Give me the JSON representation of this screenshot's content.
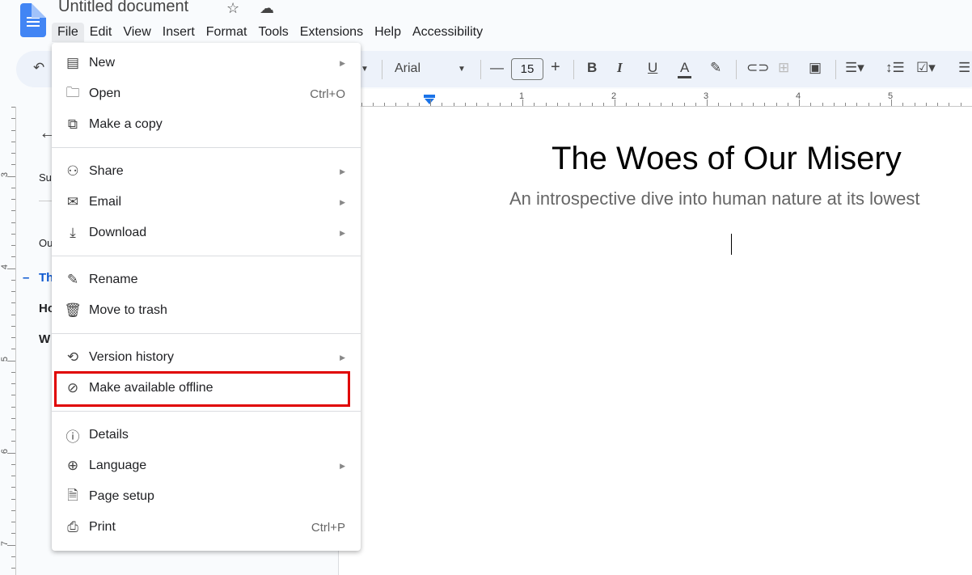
{
  "app": {
    "title": "Untitled document",
    "menu": [
      "File",
      "Edit",
      "View",
      "Insert",
      "Format",
      "Tools",
      "Extensions",
      "Help",
      "Accessibility"
    ]
  },
  "toolbar": {
    "font": "Arial",
    "font_size": "15"
  },
  "ruler": {
    "h": [
      "1",
      "2",
      "3",
      "4",
      "5"
    ],
    "v": [
      "3",
      "4",
      "5",
      "6",
      "7"
    ]
  },
  "sidebar": {
    "summary": "Su",
    "outline": "Ou",
    "items": [
      "Th",
      "Ho",
      "W"
    ],
    "accent": "#0b57d0"
  },
  "document": {
    "title": "The Woes of Our Misery",
    "subtitle": "An introspective dive into human nature at its lowest"
  },
  "file_menu": {
    "groups": [
      [
        {
          "label": "New",
          "icon": "document-icon",
          "submenu": true
        },
        {
          "label": "Open",
          "icon": "folder-icon",
          "shortcut": "Ctrl+O"
        },
        {
          "label": "Make a copy",
          "icon": "copy-icon"
        }
      ],
      [
        {
          "label": "Share",
          "icon": "person-add-icon",
          "submenu": true
        },
        {
          "label": "Email",
          "icon": "email-icon",
          "submenu": true
        },
        {
          "label": "Download",
          "icon": "download-icon",
          "submenu": true
        }
      ],
      [
        {
          "label": "Rename",
          "icon": "rename-icon"
        },
        {
          "label": "Move to trash",
          "icon": "trash-icon"
        }
      ],
      [
        {
          "label": "Version history",
          "icon": "history-icon",
          "submenu": true
        },
        {
          "label": "Make available offline",
          "icon": "offline-icon",
          "highlighted": true
        }
      ],
      [
        {
          "label": "Details",
          "icon": "info-icon"
        },
        {
          "label": "Language",
          "icon": "globe-icon",
          "submenu": true
        },
        {
          "label": "Page setup",
          "icon": "page-icon"
        },
        {
          "label": "Print",
          "icon": "print-icon",
          "shortcut": "Ctrl+P"
        }
      ]
    ],
    "highlight_color": "#e00000"
  }
}
